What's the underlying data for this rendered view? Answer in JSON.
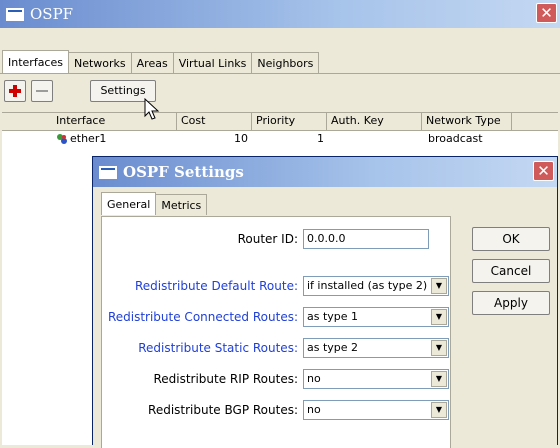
{
  "main_window": {
    "title": "OSPF",
    "close_glyph": "✕",
    "tabs": [
      "Interfaces",
      "Networks",
      "Areas",
      "Virtual Links",
      "Neighbors"
    ],
    "active_tab": "Interfaces",
    "toolbar": {
      "add_icon": "plus-icon",
      "remove_icon": "minus-icon",
      "settings_label": "Settings"
    },
    "table": {
      "columns": [
        "Interface",
        "Cost",
        "Priority",
        "Auth. Key",
        "Network Type"
      ],
      "rows": [
        {
          "interface": "ether1",
          "cost": "10",
          "priority": "1",
          "auth_key": "",
          "network_type": "broadcast"
        }
      ]
    }
  },
  "dialog": {
    "title": "OSPF Settings",
    "close_glyph": "✕",
    "tabs": [
      "General",
      "Metrics"
    ],
    "active_tab": "General",
    "buttons": {
      "ok": "OK",
      "cancel": "Cancel",
      "apply": "Apply"
    },
    "fields": {
      "router_id": {
        "label": "Router ID:",
        "value": "0.0.0.0"
      },
      "redist_default": {
        "label": "Redistribute Default Route:",
        "value": "if installed (as type 2)"
      },
      "redist_connected": {
        "label": "Redistribute Connected Routes:",
        "value": "as type 1"
      },
      "redist_static": {
        "label": "Redistribute Static Routes:",
        "value": "as type 2"
      },
      "redist_rip": {
        "label": "Redistribute RIP Routes:",
        "value": "no"
      },
      "redist_bgp": {
        "label": "Redistribute BGP Routes:",
        "value": "no"
      }
    }
  },
  "colors": {
    "title_start": "#6a8ccf",
    "title_end": "#c4d8f2",
    "blue_label": "#1f3fd8",
    "close_red": "#d05a5a"
  }
}
